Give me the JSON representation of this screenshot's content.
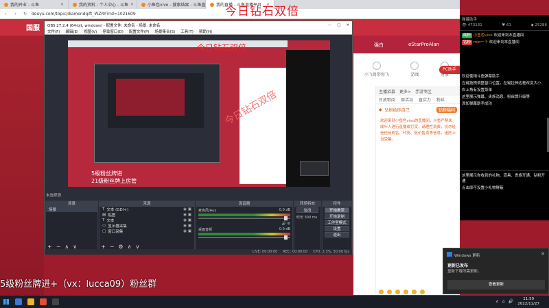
{
  "browser": {
    "tabs": [
      {
        "label": "我的开业 - 斗鱼",
        "active": false
      },
      {
        "label": "我的资料 - 个人中心 - 斗鱼",
        "active": false
      },
      {
        "label": "小鱼色vivo - 搜索结果 - 斗鱼直播",
        "active": false
      },
      {
        "label": "我的直播 - 斗鱼直播平台",
        "active": true
      }
    ],
    "url": "douyu.com/topic/diamondgift_WZRY?rid=1021609"
  },
  "page": {
    "logo": "国服",
    "banner_tabs": [
      "强白",
      "eStarProAlan"
    ],
    "icons": [
      "小飞哥带你飞",
      "游戏",
      "分享"
    ],
    "panel_head": [
      "主播招募",
      "更多>",
      "手游专区"
    ],
    "panel_tabs": [
      "日皮取阅",
      "周活动",
      "直实力",
      "粉丝"
    ],
    "pc_badge": "PC助手",
    "rank_label": "钻粉给你自己",
    "rank_btn": "钻粉福利",
    "chat_notice": "欢迎来到小鱼色vivo的直播间，斗鱼严禁未成年人进行直播或打赏，请理性消费，切勿轻信任何刷钻、代充、低价售卖等信息，谨防上当受骗。"
  },
  "obs": {
    "title": "OBS 27.2.4 (64-bit, windows) - 配置文件: 未命名 - 场景: 未命名",
    "menu": [
      "文件(F)",
      "编辑(E)",
      "视图(V)",
      "停靠窗口(D)",
      "配置文件(P)",
      "场景集合(S)",
      "工具(T)",
      "帮助(H)"
    ],
    "window_controls": [
      "—",
      "□",
      "✕"
    ],
    "scene_label": "未选择源",
    "dock_titles": [
      "场景",
      "来源",
      "混音器",
      "转场特效",
      "控件"
    ],
    "scene_item": "场景",
    "sources": [
      "文本 (GDI+)",
      "贴图",
      "文本",
      "显示器采集",
      "窗口采集"
    ],
    "mixer": [
      {
        "name": "麦克风/Aux",
        "db": "0.0 dB"
      },
      {
        "name": "桌面音频",
        "db": "0.0 dB"
      }
    ],
    "transition": {
      "type": "淡出",
      "duration_label": "时长",
      "duration": "300 ms"
    },
    "controls": [
      "开始推流",
      "开始录制",
      "工作室模式",
      "设置",
      "退出"
    ],
    "status": [
      "LIVE: 00:00:00",
      "REC: 00:00:00",
      "CPU: 2.3%, 30.00 fps"
    ],
    "preview_title": "今日钻石双倍",
    "preview_fan1": "5级粉丝牌进",
    "preview_fan2": "21级粉丝牌上房管"
  },
  "overlay": {
    "title": "今日钻石双倍",
    "fan1": "5级粉丝牌进+（vx：lucca09）粉丝群",
    "fan2": "21级粉丝牌上房管"
  },
  "chat": {
    "header": "弹幕助手",
    "stats": [
      "473131",
      "61",
      "25286"
    ],
    "messages": [
      {
        "badge": "纯粉",
        "badge_color": "#2da44e",
        "name": "小鱼色vivo",
        "text": "欢迎来到本直播间"
      },
      {
        "badge": "钻粉",
        "badge_color": "#d43b3b",
        "name": "mio一下",
        "text": "欢迎来到本直播间"
      }
    ],
    "help": [
      "欢迎使用斗鱼弹幕助手",
      "左键拖拽调整窗口位置，左键拉伸边框改变大小",
      "右上角有设置菜单",
      "这里展示弹幕、贵族消息、粉丝牌升级等",
      "添加弹幕助手成功"
    ],
    "gift_lines": [
      "这里展示你收到的礼物、道具、贵族开通、钻粉开通",
      "点击即可设置小礼物屏蔽"
    ]
  },
  "toast": {
    "app": "Windows 更新",
    "heading": "更新已发布",
    "body": "重新下载所需更新。",
    "button": "查看更新"
  },
  "taskbar": {
    "time": "11:59",
    "date": "2022/11/27"
  }
}
